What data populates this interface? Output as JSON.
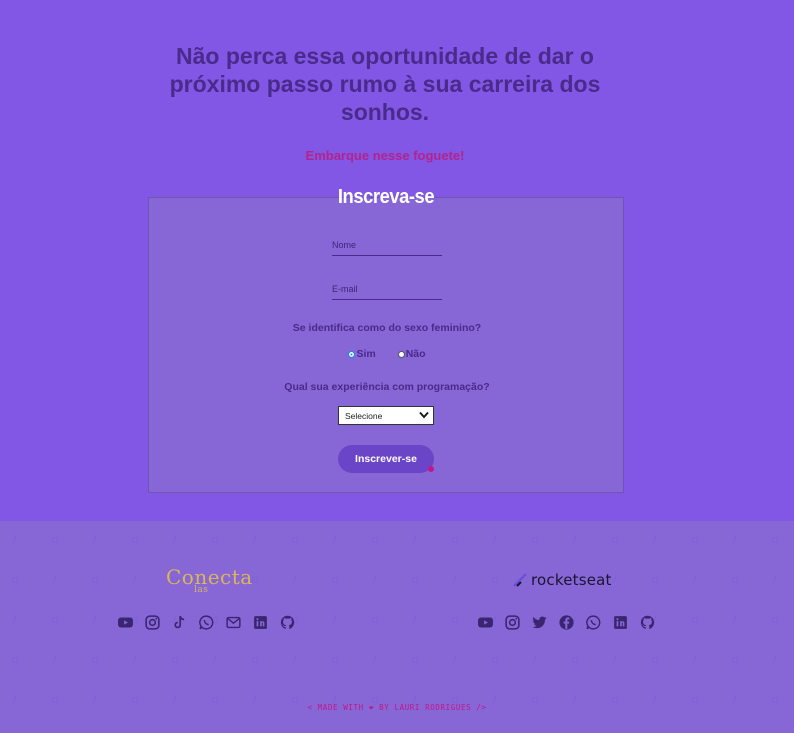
{
  "hero": {
    "title": "Não perca essa oportunidade de dar o próximo passo rumo à sua carreira dos sonhos.",
    "subtitle": "Embarque nesse foguete!"
  },
  "form": {
    "title": "Inscreva-se",
    "name_placeholder": "Nome",
    "email_placeholder": "E-mail",
    "gender_question": "Se identifica como do sexo feminino?",
    "gender_options": [
      {
        "label": "Sim",
        "checked": true
      },
      {
        "label": "Não",
        "checked": false
      }
    ],
    "experience_question": "Qual sua experiência com programação?",
    "experience_selected": "Selecione",
    "submit_label": "Inscrever-se"
  },
  "footer": {
    "left_logo": {
      "name": "Conecta",
      "sub": "las"
    },
    "right_logo": {
      "name": "rocketseat"
    },
    "left_icons": [
      "youtube-icon",
      "instagram-icon",
      "tiktok-icon",
      "whatsapp-icon",
      "mail-icon",
      "linkedin-icon",
      "github-icon"
    ],
    "right_icons": [
      "youtube-icon",
      "instagram-icon",
      "twitter-icon",
      "facebook-icon",
      "whatsapp-icon",
      "linkedin-icon",
      "github-icon"
    ],
    "credit_prefix": "< MADE WITH",
    "credit_suffix": "BY LAURI RODRIGUES />"
  },
  "colors": {
    "background": "#8257e5",
    "panel": "#8766d6",
    "accent_pink": "#c2178a",
    "text_dark": "#4a2a8a",
    "logo_gold": "#d9b65a"
  }
}
